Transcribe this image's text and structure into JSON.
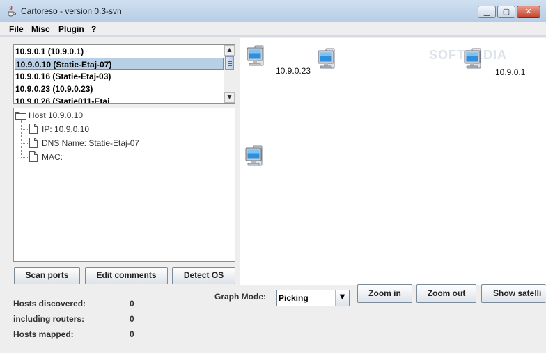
{
  "window": {
    "title": "Cartoreso - version 0.3-svn",
    "minimize_glyph": "▁",
    "maximize_glyph": "▢",
    "close_glyph": "✕"
  },
  "menu": [
    "File",
    "Misc",
    "Plugin",
    "?"
  ],
  "host_list": {
    "items": [
      "10.9.0.1 (10.9.0.1)",
      "10.9.0.10 (Statie-Etaj-07)",
      "10.9.0.16 (Statie-Etaj-03)",
      "10.9.0.23 (10.9.0.23)",
      "10.9.0.26 (Statie011-Etaj"
    ],
    "selected_index": 1
  },
  "tree": {
    "root": "Host 10.9.0.10",
    "children": [
      "IP: 10.9.0.10",
      "DNS Name: Statie-Etaj-07",
      "MAC:"
    ]
  },
  "buttons": {
    "scan_ports": "Scan ports",
    "edit_comments": "Edit comments",
    "detect_os": "Detect OS",
    "zoom_in": "Zoom in",
    "zoom_out": "Zoom out",
    "show_satellite": "Show satelli"
  },
  "graph": {
    "watermark": "SOFTPEDIA",
    "nodes": [
      {
        "label": "10.9.0.23"
      },
      {
        "label": ""
      },
      {
        "label": "10.9.0.1"
      },
      {
        "label": ""
      }
    ]
  },
  "stats": [
    {
      "label": "Hosts discovered:",
      "value": "0"
    },
    {
      "label": "including routers:",
      "value": "0"
    },
    {
      "label": "Hosts mapped:",
      "value": "0"
    }
  ],
  "graph_mode": {
    "label": "Graph Mode:",
    "value": "Picking"
  },
  "icons": {
    "app": "java-cup-icon",
    "computer": "computer-icon",
    "folder": "folder-icon",
    "document": "document-icon"
  }
}
